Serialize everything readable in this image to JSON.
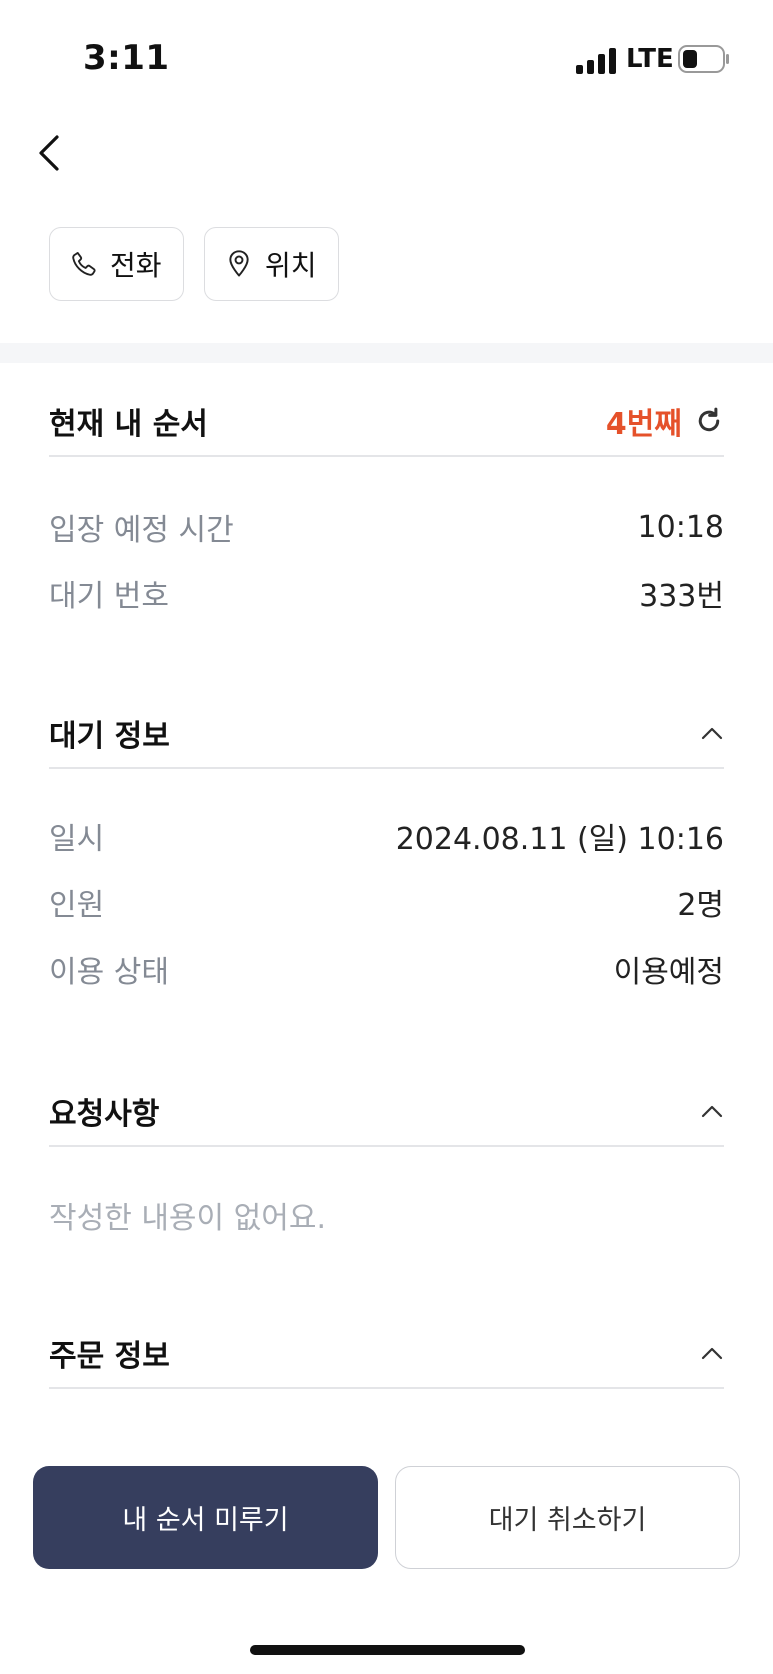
{
  "status_bar": {
    "time": "3:11",
    "network": "LTE"
  },
  "actions": {
    "call_label": "전화",
    "location_label": "위치"
  },
  "queue": {
    "title": "현재 내 순서",
    "position": "4번째",
    "rows": [
      {
        "label": "입장 예정 시간",
        "value": "10:18"
      },
      {
        "label": "대기 번호",
        "value": "333번"
      }
    ]
  },
  "waiting_info": {
    "title": "대기 정보",
    "rows": [
      {
        "label": "일시",
        "value": "2024.08.11 (일) 10:16"
      },
      {
        "label": "인원",
        "value": "2명"
      },
      {
        "label": "이용 상태",
        "value": "이용예정"
      }
    ]
  },
  "requests": {
    "title": "요청사항",
    "empty_text": "작성한 내용이 없어요."
  },
  "order_info": {
    "title": "주문 정보"
  },
  "buttons": {
    "postpone": "내 순서 미루기",
    "cancel": "대기 취소하기"
  },
  "colors": {
    "accent": "#e5512a",
    "primary_button": "#363e5e"
  }
}
